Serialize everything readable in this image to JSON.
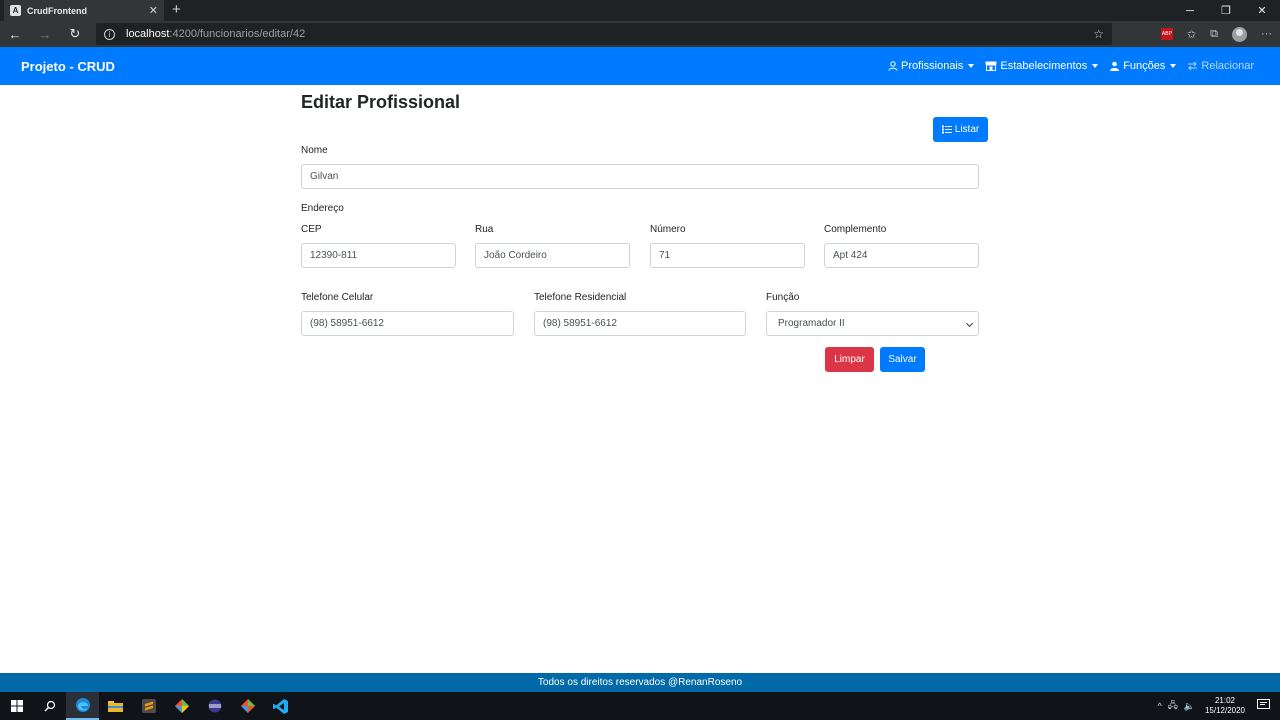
{
  "browser": {
    "tab_title": "CrudFrontend",
    "tab_favicon": "A",
    "url_host": "localhost",
    "url_path": ":4200/funcionarios/editar/42",
    "ext_abp": "ABP"
  },
  "navbar": {
    "brand": "Projeto - CRUD",
    "items": [
      {
        "label": "Profissionais",
        "icon": "user-icon"
      },
      {
        "label": "Estabelecimentos",
        "icon": "store-icon"
      },
      {
        "label": "Funções",
        "icon": "users-icon"
      },
      {
        "label": "Relacionar",
        "icon": "exchange-icon",
        "disabled": true
      }
    ]
  },
  "page": {
    "title": "Editar Profissional",
    "listar_label": "Listar"
  },
  "form": {
    "nome_label": "Nome",
    "nome_value": "Gilvan",
    "endereco_label": "Endereço",
    "cep_label": "CEP",
    "cep_value": "12390-811",
    "rua_label": "Rua",
    "rua_value": "João Cordeiro",
    "numero_label": "Número",
    "numero_value": "71",
    "complemento_label": "Complemento",
    "complemento_value": "Apt 424",
    "celular_label": "Telefone Celular",
    "celular_value": "(98) 58951-6612",
    "residencial_label": "Telefone Residencial",
    "residencial_value": "(98) 58951-6612",
    "funcao_label": "Função",
    "funcao_value": "Programador II",
    "limpar_label": "Limpar",
    "salvar_label": "Salvar"
  },
  "footer": {
    "text": "Todos os direitos reservados @RenanRoseno"
  },
  "taskbar": {
    "time": "21:02",
    "date": "15/12/2020",
    "notification_count": "1"
  },
  "colors": {
    "primary": "#007bff",
    "danger": "#dc3545",
    "footer": "#006aa8"
  }
}
